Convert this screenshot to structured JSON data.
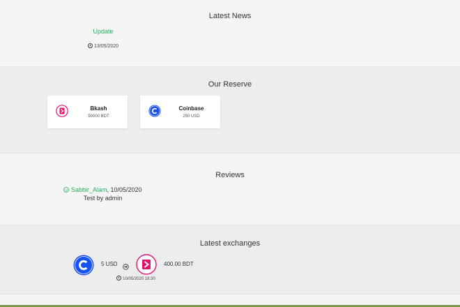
{
  "news": {
    "title": "Latest News",
    "items": [
      {
        "label": "Update",
        "date": "13/05/2020"
      }
    ]
  },
  "reserve": {
    "title": "Our Reserve",
    "items": [
      {
        "name": "Bkash",
        "amount": "50000 BDT",
        "icon": "bkash-icon"
      },
      {
        "name": "Coinbase",
        "amount": "250 USD",
        "icon": "coinbase-icon"
      }
    ]
  },
  "reviews": {
    "title": "Reviews",
    "items": [
      {
        "user": "Sabbir_Alam",
        "date": ", 10/05/2020",
        "text": "Test by admin"
      }
    ]
  },
  "exchanges": {
    "title": "Latest exchanges",
    "items": [
      {
        "from_amount": "5 USD",
        "to_amount": "400.00 BDT",
        "date": "10/05/2020 18:30",
        "from_icon": "coinbase-icon",
        "to_icon": "bkash-icon"
      }
    ]
  },
  "colors": {
    "accent_green": "#27ae60",
    "coinbase_blue": "#1652f0",
    "bkash_pink": "#e2136e",
    "footer_line": "#7a9a4a"
  }
}
